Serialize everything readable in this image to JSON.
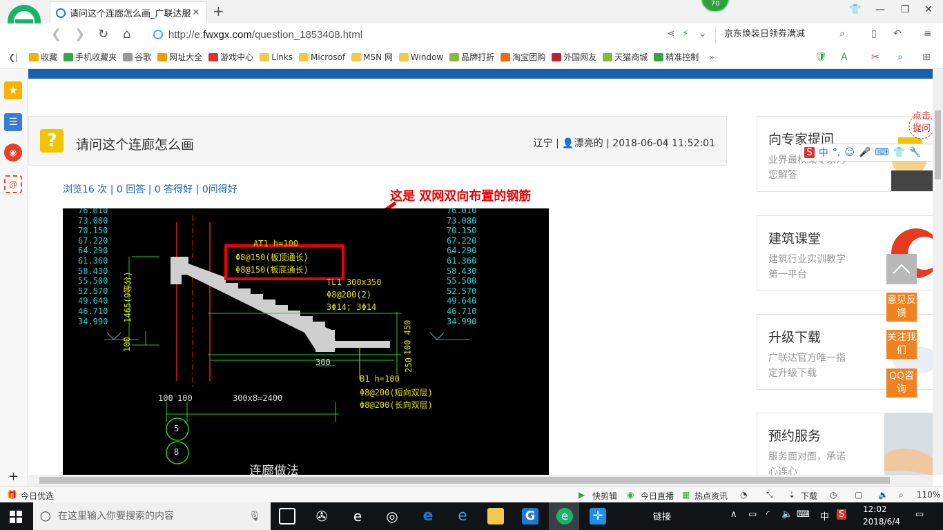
{
  "browser": {
    "tab_title": "请问这个连廊怎么画_广联达服务",
    "badge": "70",
    "url_prefix": "http://e.",
    "url_domain": "fwxgx.com",
    "url_path": "/question_1853408.html",
    "search_text": "京东焕装日领券满减"
  },
  "bookmarks": [
    {
      "label": "收藏",
      "color": "#f2b400"
    },
    {
      "label": "手机收藏夹",
      "color": "#3aa34a"
    },
    {
      "label": "谷歌",
      "color": "#999999"
    },
    {
      "label": "网址大全",
      "color": "#e8a000"
    },
    {
      "label": "游戏中心",
      "color": "#e03030"
    },
    {
      "label": "Links",
      "color": "#f2c94c"
    },
    {
      "label": "Microsof",
      "color": "#f2c94c"
    },
    {
      "label": "MSN 网",
      "color": "#f2c94c"
    },
    {
      "label": "Window",
      "color": "#f2c94c"
    },
    {
      "label": "品牌打折",
      "color": "#8bb83a"
    },
    {
      "label": "淘宝团购",
      "color": "#f26a10"
    },
    {
      "label": "外国网友",
      "color": "#c0202a"
    },
    {
      "label": "天猫商城",
      "color": "#8bb83a"
    },
    {
      "label": "精准控制",
      "color": "#3aa34a"
    }
  ],
  "question": {
    "title": "请问这个连廊怎么画",
    "meta": "辽宁 | 👤漂亮的 | 2018-06-04 11:52:01",
    "stats": "浏览16 次 | 0 回答 | 0 答得好 | 0问得好",
    "annotation": "这是 双网双向布置的钢筋"
  },
  "cad": {
    "elevations_left": [
      "76.010",
      "73.080",
      "70.150",
      "67.220",
      "64.290",
      "61.360",
      "58.430",
      "55.500",
      "52.570",
      "49.640",
      "46.710",
      "34.990"
    ],
    "elevations_right": [
      "76.010",
      "73.080",
      "70.150",
      "67.220",
      "64.290",
      "61.360",
      "58.430",
      "55.500",
      "52.570",
      "49.640",
      "46.710",
      "34.990"
    ],
    "at_label": "AT1  h=100",
    "rebar1": "Φ8@150(板顶通长)",
    "rebar2": "Φ8@150(板底通长)",
    "tl_label": "TL1 300x350",
    "tl_stirrup": "Φ8@200(2)",
    "tl_bars": "3Φ14; 3Φ14",
    "b1_label": "B1  h=100",
    "b1_rebar1": "Φ8@200(短向双层)",
    "b1_rebar2": "Φ8@200(长向双层)",
    "dim_bottom": "300x8=2400",
    "dim_100a": "100",
    "dim_100b": "100",
    "dim_300": "300",
    "dim_1465": "1465(9等分)",
    "dim_side": "100",
    "dim_450": "100 450",
    "dim_250": "250",
    "axis1": "5",
    "axis2": "8",
    "caption": "连廊做法"
  },
  "cards": [
    {
      "title": "向专家提问",
      "desc": "业界最权威专家为您解答"
    },
    {
      "title": "建筑课堂",
      "desc": "建筑行业实训教学第一平台"
    },
    {
      "title": "升级下载",
      "desc": "广联达官方唯一指定升级下载"
    },
    {
      "title": "预约服务",
      "desc": "服务面对面，承诺心连心"
    }
  ],
  "float": {
    "feedback": "意见反馈",
    "follow": "关注我们",
    "qq": "QQ咨询",
    "click_hint": "点击提问"
  },
  "ime": {
    "items": [
      "中",
      "°,",
      "☺",
      "🎤",
      "⌨",
      "👕",
      "🔧"
    ]
  },
  "statusbar": {
    "left": "今日优选",
    "kuaijianji": "快剪辑",
    "zhibo": "今日直播",
    "news": "热点资讯",
    "download": "下载",
    "zoom": "110%"
  },
  "taskbar": {
    "search_placeholder": "在这里输入你要搜索的内容",
    "link": "链接",
    "ime": "中",
    "time": "12:02",
    "date": "2018/6/4"
  }
}
